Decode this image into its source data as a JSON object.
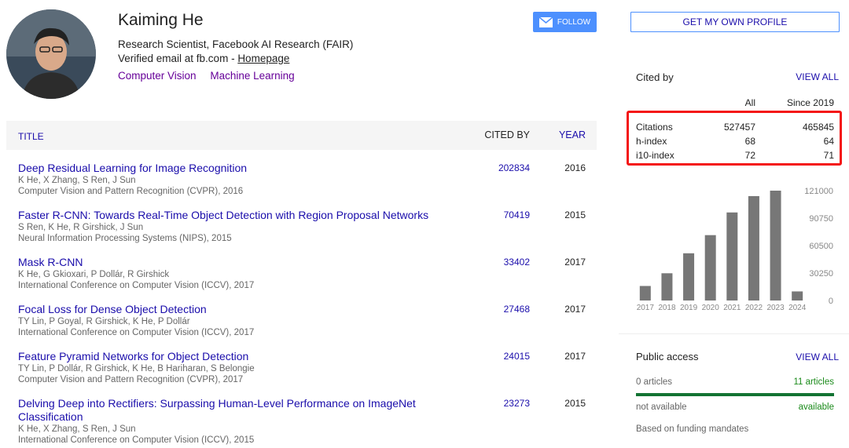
{
  "profile": {
    "name": "Kaiming He",
    "affiliation": "Research Scientist, Facebook AI Research (FAIR)",
    "email_prefix": "Verified email at fb.com - ",
    "homepage_label": "Homepage",
    "interests": [
      "Computer Vision",
      "Machine Learning"
    ],
    "follow_label": "FOLLOW"
  },
  "table": {
    "col_title": "TITLE",
    "col_cited": "CITED BY",
    "col_year": "YEAR",
    "rows": [
      {
        "title": "Deep Residual Learning for Image Recognition",
        "authors": "K He, X Zhang, S Ren, J Sun",
        "venue": "Computer Vision and Pattern Recognition (CVPR), 2016",
        "cited": "202834",
        "year": "2016"
      },
      {
        "title": "Faster R-CNN: Towards Real-Time Object Detection with Region Proposal Networks",
        "authors": "S Ren, K He, R Girshick, J Sun",
        "venue": "Neural Information Processing Systems (NIPS), 2015",
        "cited": "70419",
        "year": "2015"
      },
      {
        "title": "Mask R-CNN",
        "authors": "K He, G Gkioxari, P Dollár, R Girshick",
        "venue": "International Conference on Computer Vision (ICCV), 2017",
        "cited": "33402",
        "year": "2017"
      },
      {
        "title": "Focal Loss for Dense Object Detection",
        "authors": "TY Lin, P Goyal, R Girshick, K He, P Dollár",
        "venue": "International Conference on Computer Vision (ICCV), 2017",
        "cited": "27468",
        "year": "2017"
      },
      {
        "title": "Feature Pyramid Networks for Object Detection",
        "authors": "TY Lin, P Dollár, R Girshick, K He, B Hariharan, S Belongie",
        "venue": "Computer Vision and Pattern Recognition (CVPR), 2017",
        "cited": "24015",
        "year": "2017"
      },
      {
        "title": "Delving Deep into Rectifiers: Surpassing Human-Level Performance on ImageNet Classification",
        "authors": "K He, X Zhang, S Ren, J Sun",
        "venue": "International Conference on Computer Vision (ICCV), 2015",
        "cited": "23273",
        "year": "2015"
      }
    ]
  },
  "sidebar": {
    "get_profile_label": "GET MY OWN PROFILE",
    "cited_by_title": "Cited by",
    "view_all": "VIEW ALL",
    "col_all": "All",
    "col_since": "Since 2019",
    "stats": [
      {
        "label": "Citations",
        "all": "527457",
        "since": "465845"
      },
      {
        "label": "h-index",
        "all": "68",
        "since": "64"
      },
      {
        "label": "i10-index",
        "all": "72",
        "since": "71"
      }
    ],
    "highlight_color": "#f41414",
    "public_access_title": "Public access",
    "pa_left1": "0 articles",
    "pa_right1": "11 articles",
    "pa_left2": "not available",
    "pa_right2": "available",
    "pa_note": "Based on funding mandates"
  },
  "chart_data": {
    "type": "bar",
    "categories": [
      "2017",
      "2018",
      "2019",
      "2020",
      "2021",
      "2022",
      "2023",
      "2024"
    ],
    "values": [
      16000,
      30000,
      52000,
      72000,
      97000,
      115000,
      121000,
      10000
    ],
    "yticks": [
      "121000",
      "90750",
      "60500",
      "30250",
      "0"
    ],
    "ylim": [
      0,
      121000
    ]
  }
}
